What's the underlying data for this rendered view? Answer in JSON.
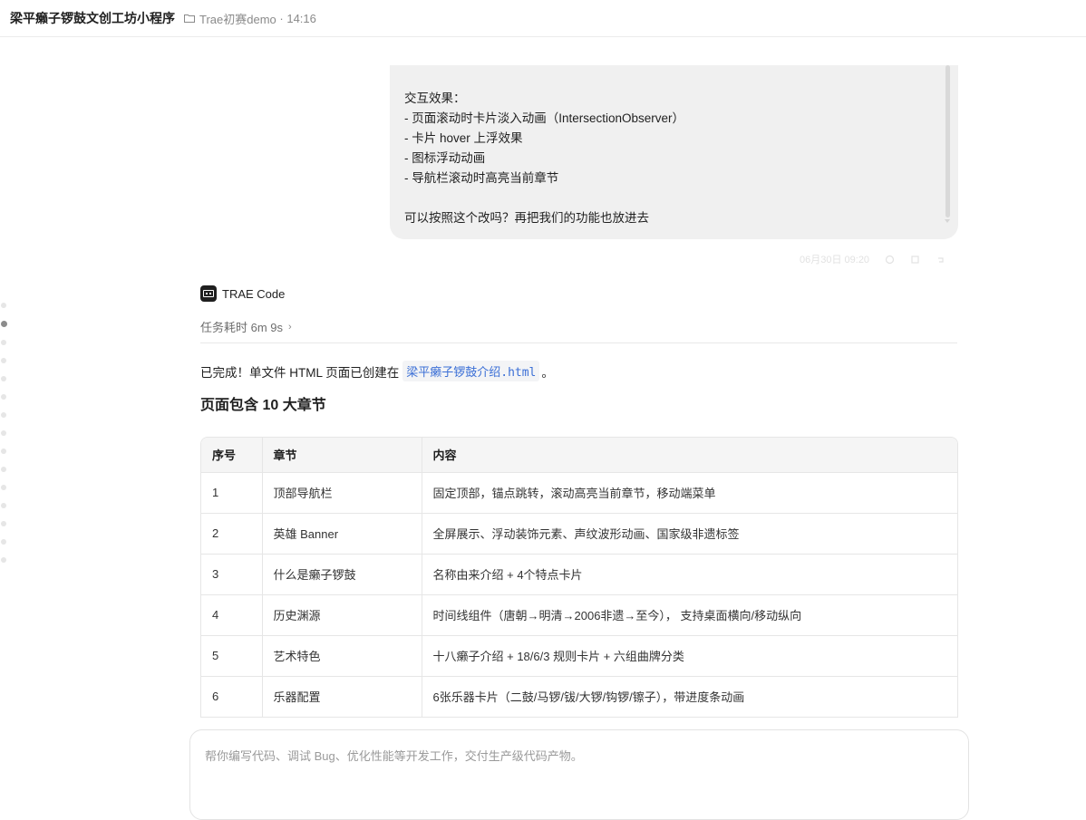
{
  "header": {
    "title": "梁平癞子锣鼓文创工坊小程序",
    "project": "Trae初赛demo",
    "time": "14:16"
  },
  "rail": {
    "dot_count": 15,
    "active_index": 1
  },
  "user_message": {
    "lines": [
      "交互效果：",
      "- 页面滚动时卡片淡入动画（IntersectionObserver）",
      "- 卡片 hover 上浮效果",
      "- 图标浮动动画",
      "- 导航栏滚动时高亮当前章节",
      "",
      "可以按照这个改吗？再把我们的功能也放进去"
    ],
    "timestamp": "06月30日 09:20"
  },
  "assistant": {
    "name": "TRAE Code",
    "task_time_label": "任务耗时 6m 9s",
    "done_prefix": "已完成！单文件 HTML 页面已创建在",
    "file_name": "梁平癞子锣鼓介绍.html",
    "done_suffix": "。",
    "section_title": "页面包含 10 大章节"
  },
  "table": {
    "headers": [
      "序号",
      "章节",
      "内容"
    ],
    "rows": [
      [
        "1",
        "顶部导航栏",
        "固定顶部，锚点跳转，滚动高亮当前章节，移动端菜单"
      ],
      [
        "2",
        "英雄 Banner",
        "全屏展示、浮动装饰元素、声纹波形动画、国家级非遗标签"
      ],
      [
        "3",
        "什么是癞子锣鼓",
        "名称由来介绍 + 4个特点卡片"
      ],
      [
        "4",
        "历史渊源",
        "时间线组件（唐朝→明清→2006非遗→至今）， 支持桌面横向/移动纵向"
      ],
      [
        "5",
        "艺术特色",
        "十八癞子介绍 + 18/6/3 规则卡片 + 六组曲牌分类"
      ],
      [
        "6",
        "乐器配置",
        "6张乐器卡片（二鼓/马锣/钹/大锣/钩锣/镲子），带进度条动画"
      ]
    ]
  },
  "input": {
    "placeholder": "帮你编写代码、调试 Bug、优化性能等开发工作，交付生产级代码产物。"
  }
}
